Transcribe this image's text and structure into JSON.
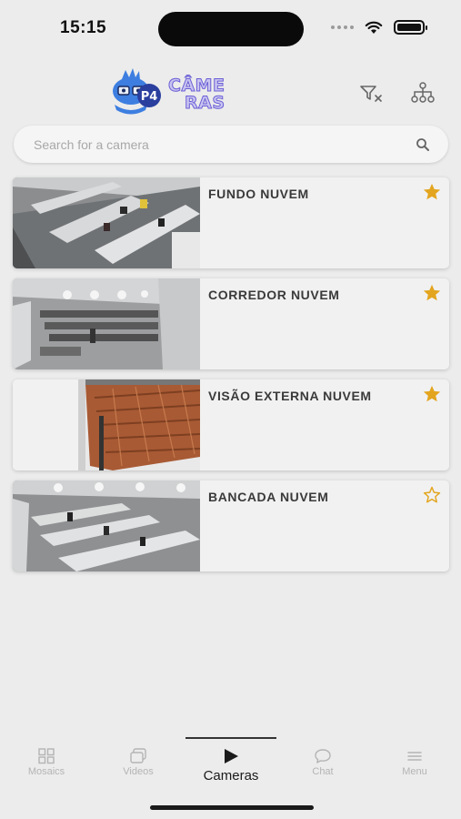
{
  "status_bar": {
    "time": "15:15"
  },
  "header": {
    "logo_line1": "CÂME",
    "logo_line2": "RAS",
    "logo_badge": "P4",
    "filter_icon": "filter-clear-icon",
    "network_icon": "network-icon"
  },
  "search": {
    "placeholder": "Search for a camera",
    "value": ""
  },
  "cameras": [
    {
      "name": "FUNDO NUVEM",
      "favorite": true
    },
    {
      "name": "CORREDOR NUVEM",
      "favorite": true
    },
    {
      "name": "VISÃO EXTERNA NUVEM",
      "favorite": true
    },
    {
      "name": "BANCADA NUVEM",
      "favorite": false
    }
  ],
  "nav": {
    "items": [
      {
        "label": "Mosaics",
        "icon": "grid-icon"
      },
      {
        "label": "Videos",
        "icon": "videos-icon"
      },
      {
        "label": "Cameras",
        "icon": "play-icon"
      },
      {
        "label": "Chat",
        "icon": "chat-icon"
      },
      {
        "label": "Menu",
        "icon": "menu-icon"
      }
    ],
    "active": "Cameras"
  },
  "colors": {
    "star": "#E3A51F",
    "accent": "#6a5ed6"
  }
}
